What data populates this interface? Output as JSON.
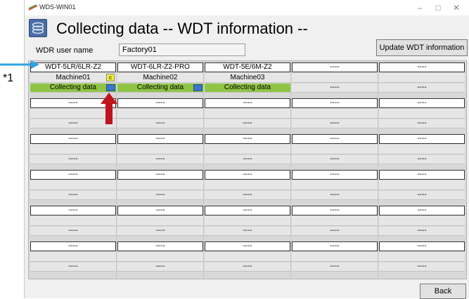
{
  "window": {
    "title": "WDS-WIN01",
    "controls": [
      "–",
      "□",
      "✕"
    ]
  },
  "heading": "Collecting data -- WDT information --",
  "user": {
    "label": "WDR user name",
    "value": "Factory01"
  },
  "buttons": {
    "update": "Update WDT information",
    "back": "Back"
  },
  "annotation": "*1",
  "c_icon": "c",
  "cells": [
    {
      "model": "WDT-5LR/6LR-Z2",
      "machine": "Machine01",
      "status": "Collecting data",
      "active": true,
      "has_c_icon": true,
      "has_blue_btn": true
    },
    {
      "model": "WDT-6LR-Z2-PRO",
      "machine": "Machine02",
      "status": "Collecting data",
      "active": true,
      "has_c_icon": false,
      "has_blue_btn": true
    },
    {
      "model": "WDT-5E/6M-Z2",
      "machine": "Machine03",
      "status": "Collecting data",
      "active": true,
      "has_c_icon": false,
      "has_blue_btn": false
    },
    {
      "model": "----",
      "machine": "",
      "status": "----",
      "active": false
    },
    {
      "model": "----",
      "machine": "",
      "status": "----",
      "active": false
    },
    {
      "model": "----",
      "machine": "",
      "status": "----",
      "active": false
    },
    {
      "model": "----",
      "machine": "",
      "status": "----",
      "active": false
    },
    {
      "model": "----",
      "machine": "",
      "status": "----",
      "active": false
    },
    {
      "model": "----",
      "machine": "",
      "status": "----",
      "active": false
    },
    {
      "model": "----",
      "machine": "",
      "status": "----",
      "active": false
    },
    {
      "model": "----",
      "machine": "",
      "status": "----",
      "active": false
    },
    {
      "model": "----",
      "machine": "",
      "status": "----",
      "active": false
    },
    {
      "model": "----",
      "machine": "",
      "status": "----",
      "active": false
    },
    {
      "model": "----",
      "machine": "",
      "status": "----",
      "active": false
    },
    {
      "model": "----",
      "machine": "",
      "status": "----",
      "active": false
    },
    {
      "model": "----",
      "machine": "",
      "status": "----",
      "active": false
    },
    {
      "model": "----",
      "machine": "",
      "status": "----",
      "active": false
    },
    {
      "model": "----",
      "machine": "",
      "status": "----",
      "active": false
    },
    {
      "model": "----",
      "machine": "",
      "status": "----",
      "active": false
    },
    {
      "model": "----",
      "machine": "",
      "status": "----",
      "active": false
    },
    {
      "model": "----",
      "machine": "",
      "status": "----",
      "active": false
    },
    {
      "model": "----",
      "machine": "",
      "status": "----",
      "active": false
    },
    {
      "model": "----",
      "machine": "",
      "status": "----",
      "active": false
    },
    {
      "model": "----",
      "machine": "",
      "status": "----",
      "active": false
    },
    {
      "model": "----",
      "machine": "",
      "status": "----",
      "active": false
    },
    {
      "model": "----",
      "machine": "",
      "status": "----",
      "active": false
    },
    {
      "model": "----",
      "machine": "",
      "status": "----",
      "active": false
    },
    {
      "model": "----",
      "machine": "",
      "status": "----",
      "active": false
    },
    {
      "model": "----",
      "machine": "",
      "status": "----",
      "active": false
    },
    {
      "model": "----",
      "machine": "",
      "status": "----",
      "active": false
    }
  ],
  "colors": {
    "active_status": "#8fc545",
    "annotation_arrow_blue": "#2ea3e0",
    "annotation_arrow_red": "#c0141b",
    "c_icon": "#f2ea3e",
    "blue_button": "#3a78c9"
  },
  "icons": {
    "app": "wds-app-icon",
    "heading": "data-collect-icon"
  }
}
